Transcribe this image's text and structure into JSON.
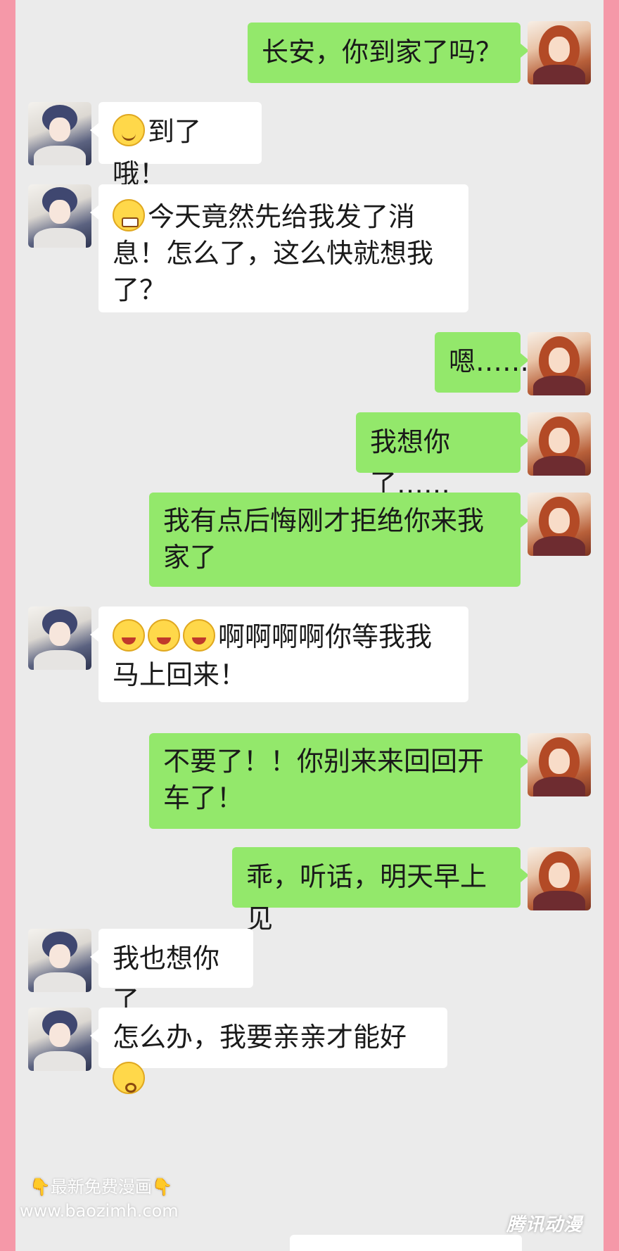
{
  "messages": [
    {
      "side": "me",
      "text": "长安，你到家了吗？"
    },
    {
      "side": "them",
      "emojis": [
        "smile-emoji"
      ],
      "text": "到了哦！"
    },
    {
      "side": "them",
      "emojis": [
        "grin-emoji"
      ],
      "text": "今天竟然先给我发了消息！怎么了，这么快就想我了？"
    },
    {
      "side": "me",
      "text": "嗯……"
    },
    {
      "side": "me",
      "text": "我想你了……"
    },
    {
      "side": "me",
      "text": "我有点后悔刚才拒绝你来我家了"
    },
    {
      "side": "them",
      "emojis": [
        "laugh-cry-emoji",
        "laugh-cry-emoji",
        "laugh-cry-emoji"
      ],
      "text": "啊啊啊啊你等我我马上回来！"
    },
    {
      "side": "me",
      "text": "不要了！！你别来来回回开车了！"
    },
    {
      "side": "me",
      "text": "乖，听话，明天早上见"
    },
    {
      "side": "them",
      "text": "我也想你了"
    },
    {
      "side": "them",
      "text": "怎么办，我要亲亲才能好",
      "trailing_emoji": "pleading-emoji"
    }
  ],
  "watermark": {
    "line1": "👇最新免费漫画👇",
    "line2": "www.baozimh.com"
  },
  "logo": "腾讯动漫",
  "colors": {
    "outer_background": "#f598a8",
    "chat_background": "#ebebeb",
    "my_bubble": "#93e86b",
    "their_bubble": "#ffffff"
  }
}
